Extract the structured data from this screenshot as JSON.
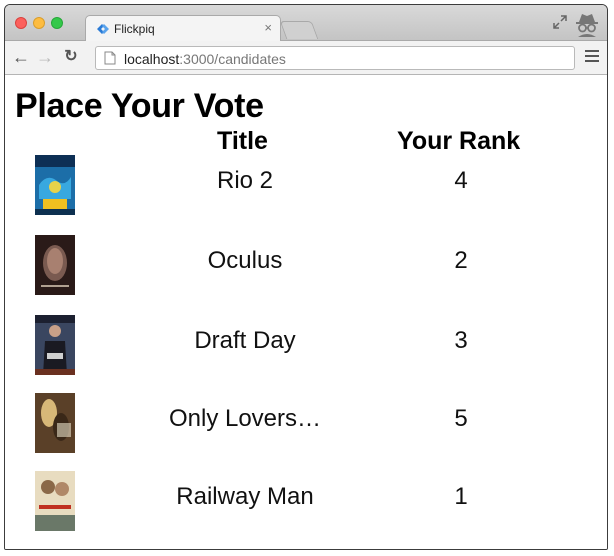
{
  "browser": {
    "tab_title": "Flickpiq",
    "tab_close": "×",
    "url_host": "localhost",
    "url_rest": ":3000/candidates"
  },
  "page": {
    "heading": "Place Your Vote",
    "col_title": "Title",
    "col_rank": "Your Rank"
  },
  "candidates": [
    {
      "title": "Rio 2",
      "rank": "4"
    },
    {
      "title": "Oculus",
      "rank": "2"
    },
    {
      "title": "Draft Day",
      "rank": "3"
    },
    {
      "title": "Only Lovers…",
      "rank": "5"
    },
    {
      "title": "Railway Man",
      "rank": "1"
    }
  ],
  "icons": {
    "back": "back-arrow-icon",
    "forward": "forward-arrow-icon",
    "reload": "reload-icon",
    "menu": "hamburger-menu-icon",
    "incognito": "incognito-icon",
    "fullscreen": "fullscreen-icon",
    "favicon": "flickpiq-favicon-icon"
  }
}
